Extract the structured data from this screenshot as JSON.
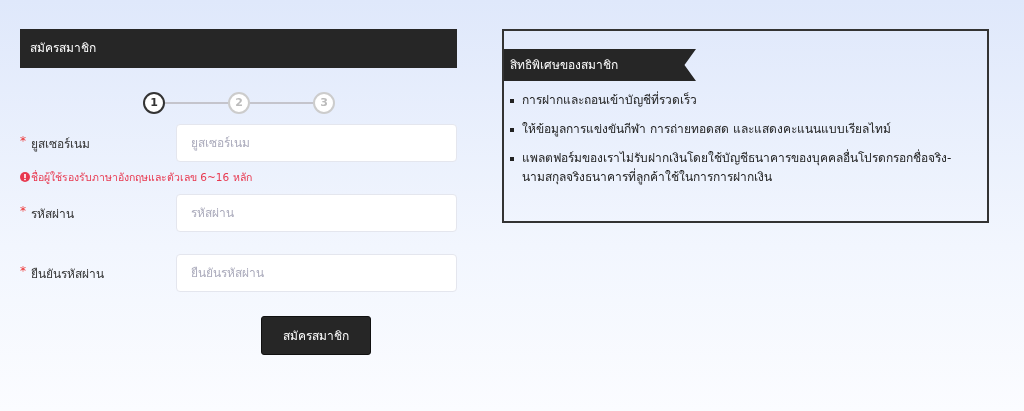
{
  "form": {
    "title": "สมัครสมาชิก",
    "steps": [
      {
        "label": "1",
        "selected": true
      },
      {
        "label": "2",
        "selected": false
      },
      {
        "label": "3",
        "selected": false
      }
    ],
    "fields": [
      {
        "required_mark": "*",
        "label": "ยูสเซอร์เนม",
        "placeholder": "ยูสเซอร์เนม",
        "hint": "ชื่อผู้ใช้รองรับภาษาอังกฤษและตัวเลข 6~16 หลัก"
      },
      {
        "required_mark": "*",
        "label": "รหัสผ่าน",
        "placeholder": "รหัสผ่าน"
      },
      {
        "required_mark": "*",
        "label": "ยืนยันรหัสผ่าน",
        "placeholder": "ยืนยันรหัสผ่าน"
      }
    ],
    "submit_button": "สมัครสมาชิก"
  },
  "benefits": {
    "title": "สิทธิพิเศษของสมาชิก",
    "items": [
      "การฝากและถอนเข้าบัญชีที่รวดเร็ว",
      "ให้ข้อมูลการแข่งขันกีฬา การถ่ายทอดสด และแสดงคะแนนแบบเรียลไทม์",
      "แพลตฟอร์มของเราไม่รับฝากเงินโดยใช้บัญชีธนาคารของบุคคลอื่นโปรดกรอกชื่อจริง-นามสกุลจริงธนาคารที่ลูกค้าใช้ในการการฝากเงิน"
    ]
  }
}
